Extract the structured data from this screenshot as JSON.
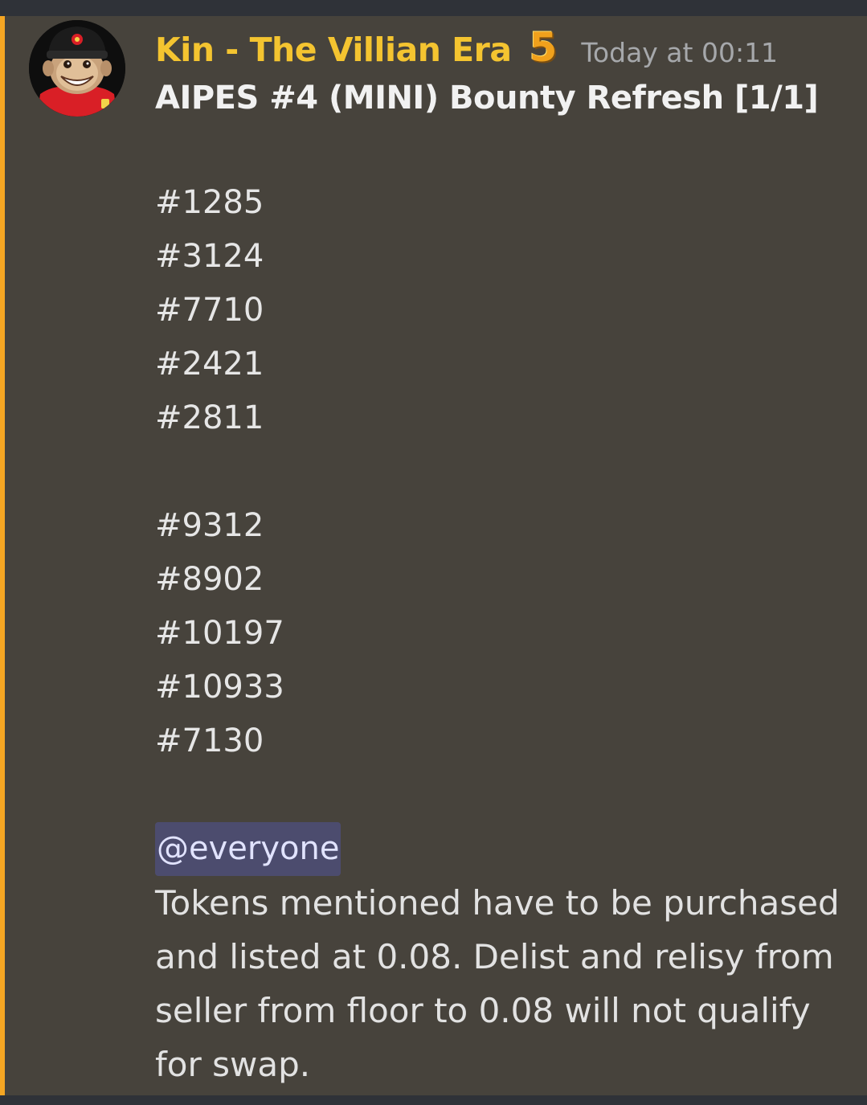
{
  "colors": {
    "highlight_bar": "#f5a623",
    "username": "#f4c430",
    "mention_bg": "#4c4c6e",
    "message_bg": "#47433c"
  },
  "message": {
    "author": "Kin - The Villian Era",
    "badge": "5",
    "timestamp": "Today at 00:11",
    "avatar_icon": "monkey-avatar",
    "title": "AIPES #4 (MINI) Bounty Refresh [1/1]",
    "token_groups": [
      [
        "#1285",
        "#3124",
        "#7710",
        "#2421",
        "#2811"
      ],
      [
        "#9312",
        "#8902",
        "#10197",
        "#10933",
        "#7130"
      ]
    ],
    "mention": "@everyone",
    "body_lines": [
      "Tokens mentioned have to be purchased",
      "and listed at 0.08. Delist and relisy from",
      "seller from floor to 0.08 will not qualify",
      "for swap."
    ]
  }
}
